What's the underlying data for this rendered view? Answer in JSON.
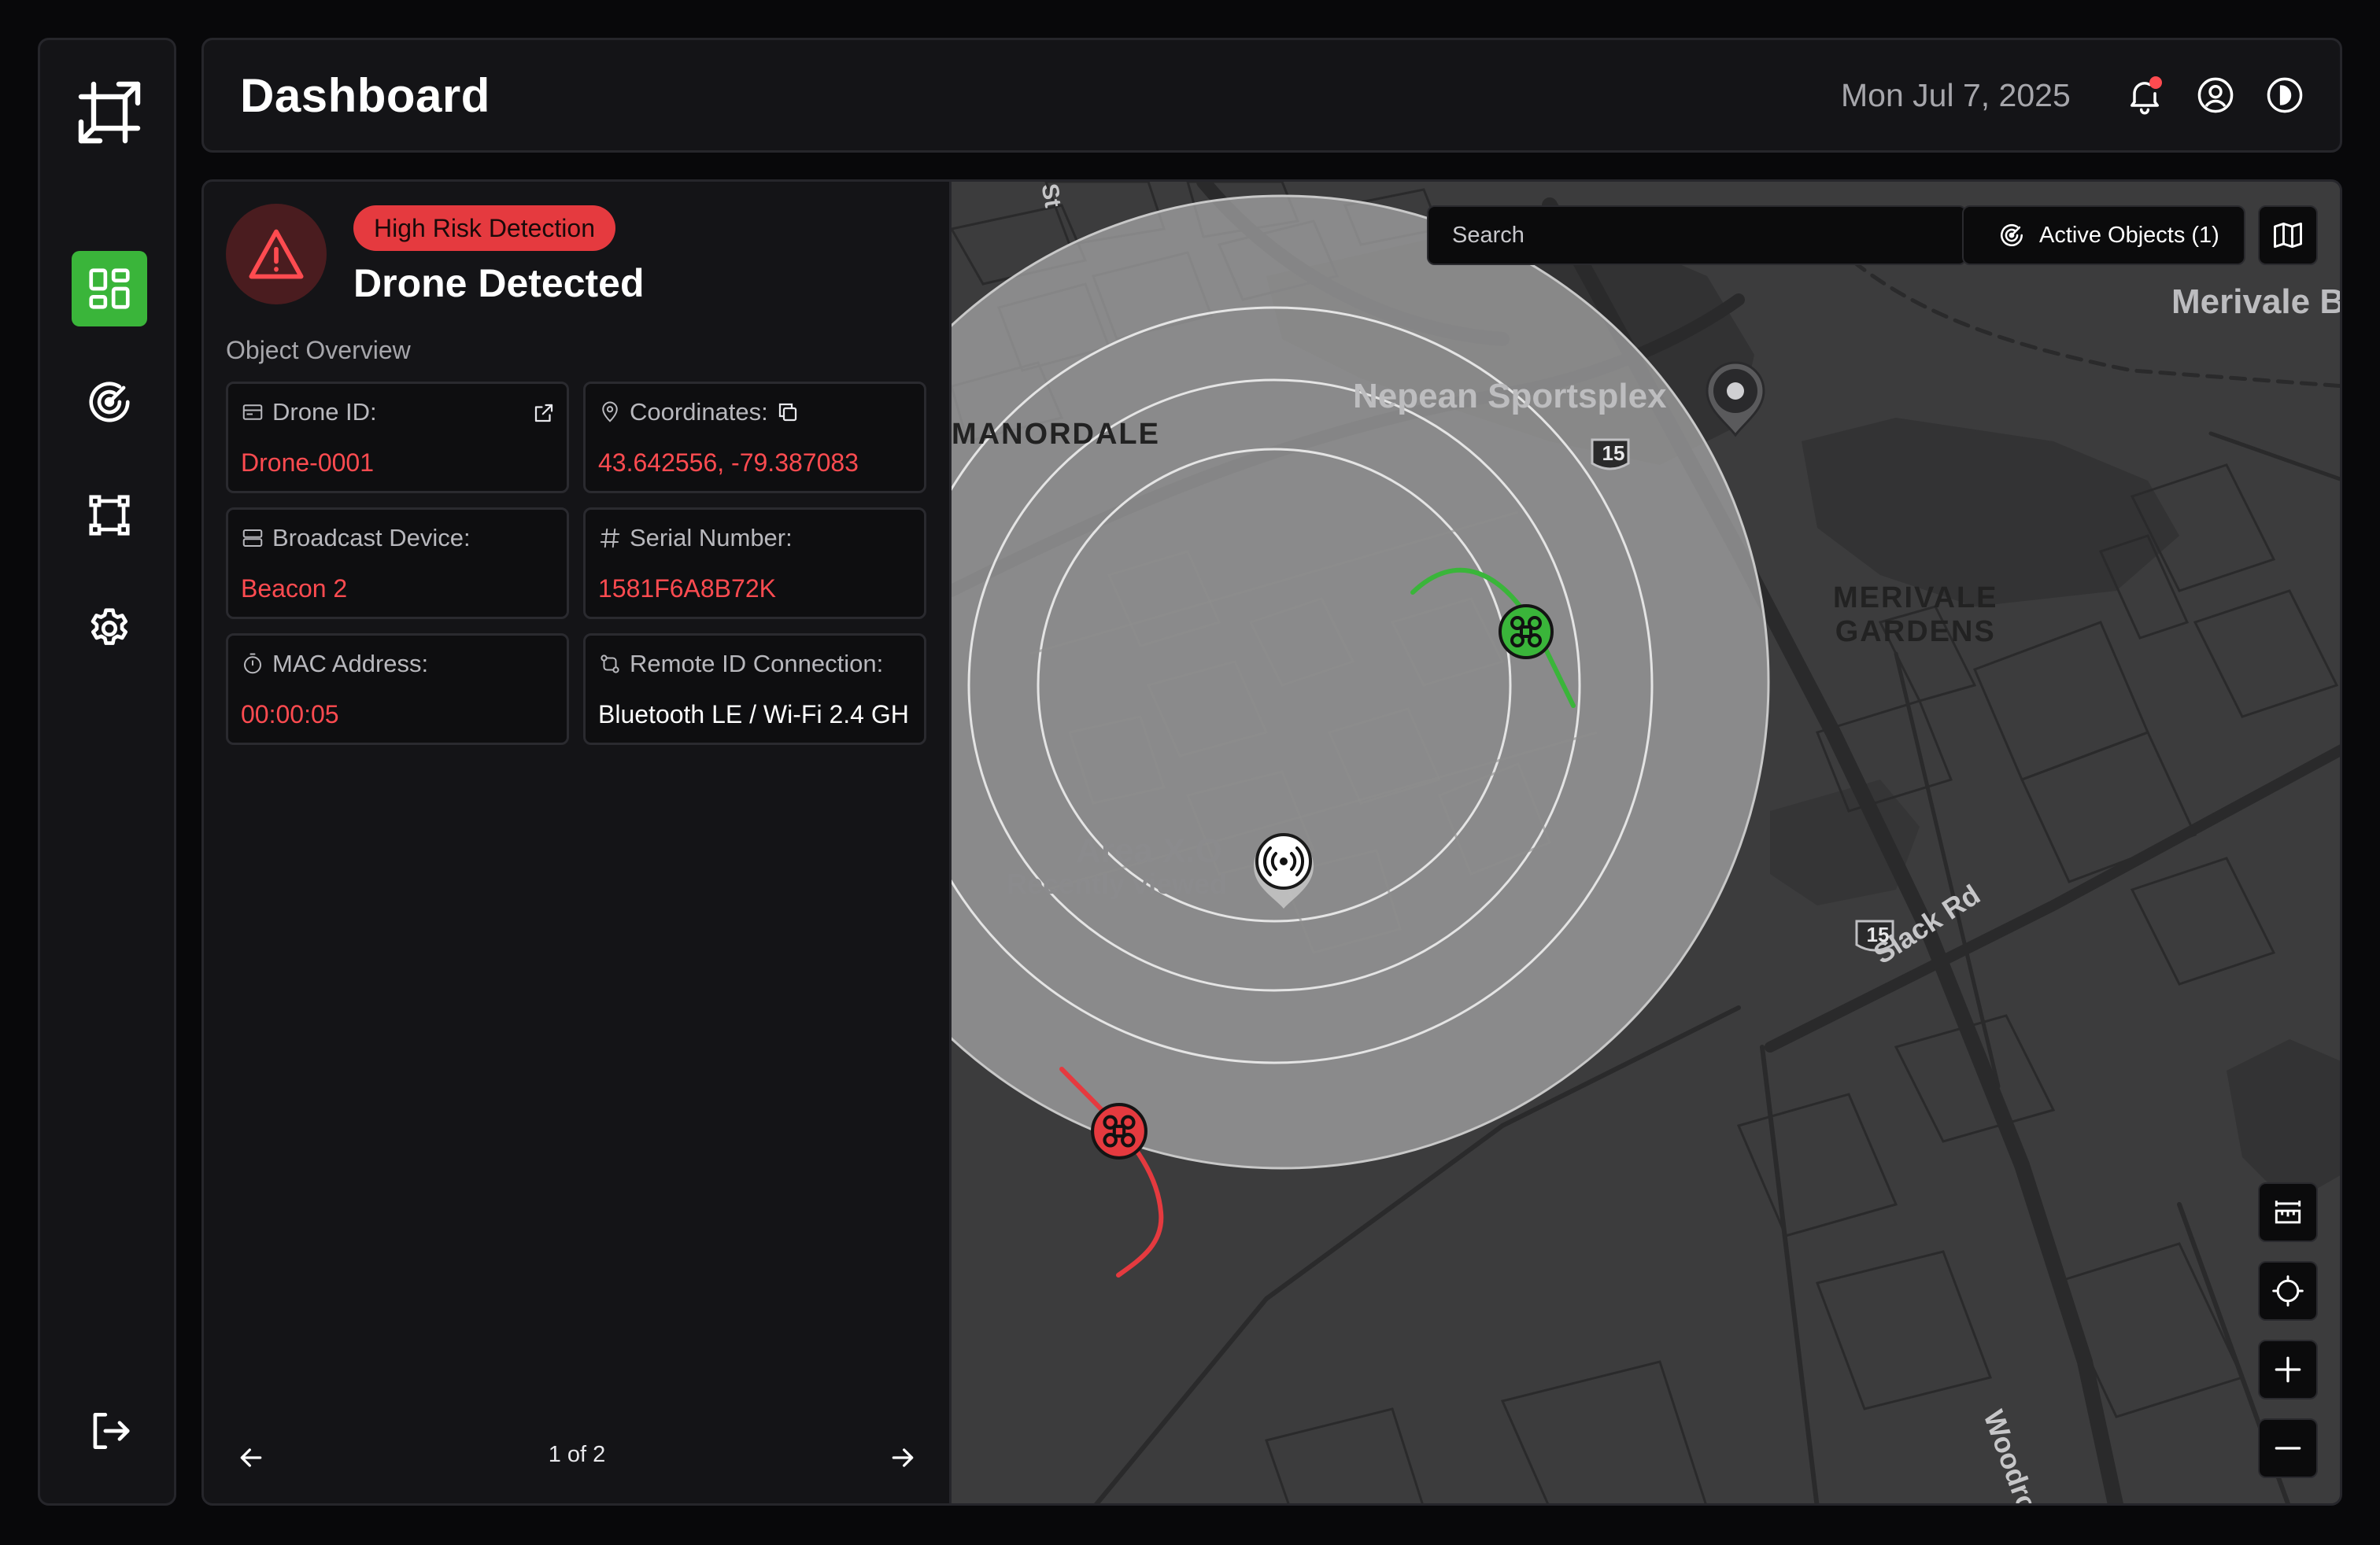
{
  "header": {
    "title": "Dashboard",
    "date": "Mon Jul 7, 2025",
    "icons": [
      "bell-icon",
      "user-icon",
      "theme-toggle-icon"
    ],
    "notification_dot_color": "#ff4b50"
  },
  "sidebar": {
    "items": [
      {
        "name": "logo",
        "icon": "crop-frame-icon"
      },
      {
        "name": "dashboard",
        "icon": "dashboard-grid-icon",
        "active": true
      },
      {
        "name": "radar",
        "icon": "radar-icon"
      },
      {
        "name": "zones",
        "icon": "bounding-box-icon"
      },
      {
        "name": "settings",
        "icon": "gear-icon"
      },
      {
        "name": "logout",
        "icon": "logout-icon"
      }
    ],
    "active_color": "#3ab53a"
  },
  "detection": {
    "badge": "High Risk Detection",
    "title": "Drone Detected",
    "section": "Object Overview",
    "fields": {
      "drone_id": {
        "label": "Drone ID:",
        "value": "Drone-0001"
      },
      "coordinates": {
        "label": "Coordinates:",
        "value": "43.642556, -79.387083"
      },
      "broadcast": {
        "label": "Broadcast Device:",
        "value": "Beacon 2"
      },
      "serial": {
        "label": "Serial Number:",
        "value": "1581F6A8B72K"
      },
      "mac": {
        "label": "MAC Address:",
        "value": "00:00:05"
      },
      "remote_id": {
        "label": "Remote ID Connection:",
        "value": "Bluetooth LE / Wi-Fi 2.4 GH"
      }
    },
    "pager": "1 of 2",
    "alert_color": "#e53a3f"
  },
  "map": {
    "search_placeholder": "Search",
    "active_objects": "Active Objects (1)",
    "labels": {
      "sportsplex": "Nepean Sportsplex",
      "manordale": "MANORDALE",
      "merivale_b": "Merivale B",
      "merivale_gardens_1": "MERIVALE",
      "merivale_gardens_2": "GARDENS",
      "area": "Area X.O",
      "recent": "Recently viewed",
      "slack": "Slack Rd",
      "woodroffe": "Woodro",
      "route_1": "15",
      "route_2": "15",
      "st": "St"
    },
    "drones": [
      {
        "name": "friendly-drone",
        "color": "#3ab53a"
      },
      {
        "name": "hostile-drone",
        "color": "#e53a3f"
      }
    ],
    "controls": [
      "ruler-icon",
      "locate-icon",
      "zoom-in-icon",
      "zoom-out-icon"
    ]
  }
}
